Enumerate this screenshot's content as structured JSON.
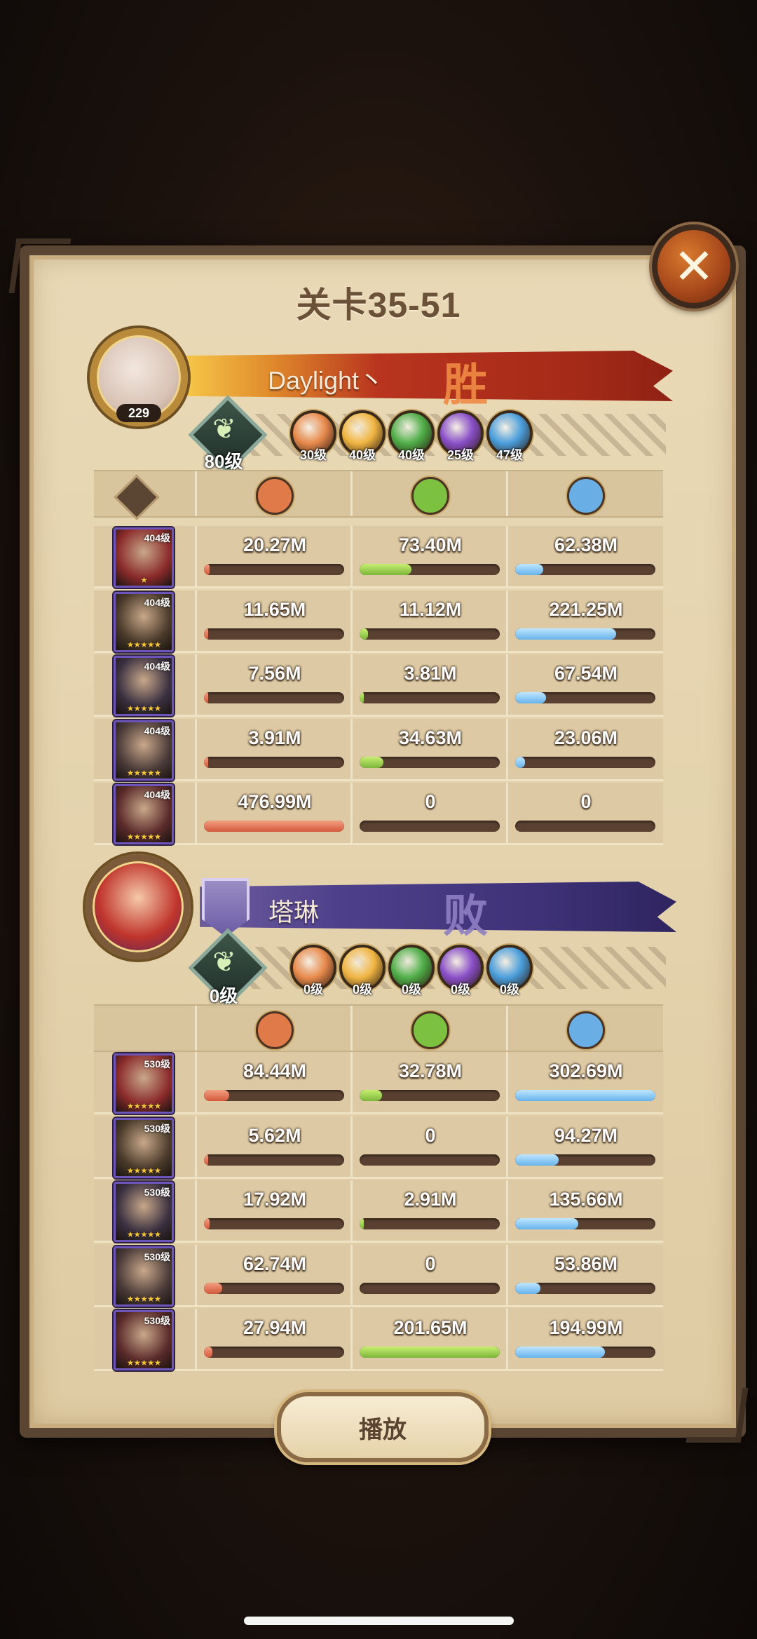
{
  "title": "关卡35-51",
  "close_icon": "close-x-icon",
  "play_label": "播放",
  "colors": {
    "faction_lightbearer": "#e88a4c",
    "faction_mauler": "#f0b542",
    "faction_wilder": "#4fae48",
    "faction_graveborn": "#8a4fc8",
    "faction_celestial": "#4a9edc",
    "damage_bar": "#d4583c",
    "heal_bar": "#7cb63a",
    "tank_bar": "#67b3ec"
  },
  "stat_icons": [
    "damage-icon",
    "heal-icon",
    "shield-icon"
  ],
  "winner": {
    "avatar_level": "229",
    "name": "Daylight丶",
    "result": "胜",
    "tree_level": "80级",
    "factions": [
      "30级",
      "40级",
      "40级",
      "25级",
      "47级"
    ],
    "heroes": [
      {
        "level": "404级",
        "stars": "★",
        "damage": "20.27M",
        "heal": "73.40M",
        "tank": "62.38M",
        "dmg_pct": 0.04,
        "heal_pct": 0.37,
        "tank_pct": 0.2
      },
      {
        "level": "404级",
        "stars": "★★★★★",
        "damage": "11.65M",
        "heal": "11.12M",
        "tank": "221.25M",
        "dmg_pct": 0.03,
        "heal_pct": 0.06,
        "tank_pct": 0.72
      },
      {
        "level": "404级",
        "stars": "★★★★★",
        "damage": "7.56M",
        "heal": "3.81M",
        "tank": "67.54M",
        "dmg_pct": 0.02,
        "heal_pct": 0.02,
        "tank_pct": 0.22
      },
      {
        "level": "404级",
        "stars": "★★★★★",
        "damage": "3.91M",
        "heal": "34.63M",
        "tank": "23.06M",
        "dmg_pct": 0.01,
        "heal_pct": 0.17,
        "tank_pct": 0.07
      },
      {
        "level": "404级",
        "stars": "★★★★★",
        "damage": "476.99M",
        "heal": "0",
        "tank": "0",
        "dmg_pct": 1.0,
        "heal_pct": 0,
        "tank_pct": 0
      }
    ]
  },
  "loser": {
    "name": "塔琳",
    "result": "败",
    "tree_level": "0级",
    "factions": [
      "0级",
      "0级",
      "0级",
      "0级",
      "0级"
    ],
    "heroes": [
      {
        "level": "530级",
        "stars": "★★★★★",
        "damage": "84.44M",
        "heal": "32.78M",
        "tank": "302.69M",
        "dmg_pct": 0.18,
        "heal_pct": 0.16,
        "tank_pct": 1.0
      },
      {
        "level": "530级",
        "stars": "★★★★★",
        "damage": "5.62M",
        "heal": "0",
        "tank": "94.27M",
        "dmg_pct": 0.02,
        "heal_pct": 0,
        "tank_pct": 0.31
      },
      {
        "level": "530级",
        "stars": "★★★★★",
        "damage": "17.92M",
        "heal": "2.91M",
        "tank": "135.66M",
        "dmg_pct": 0.04,
        "heal_pct": 0.01,
        "tank_pct": 0.45
      },
      {
        "level": "530级",
        "stars": "★★★★★",
        "damage": "62.74M",
        "heal": "0",
        "tank": "53.86M",
        "dmg_pct": 0.13,
        "heal_pct": 0,
        "tank_pct": 0.18
      },
      {
        "level": "530级",
        "stars": "★★★★★",
        "damage": "27.94M",
        "heal": "201.65M",
        "tank": "194.99M",
        "dmg_pct": 0.06,
        "heal_pct": 1.0,
        "tank_pct": 0.64
      }
    ]
  }
}
